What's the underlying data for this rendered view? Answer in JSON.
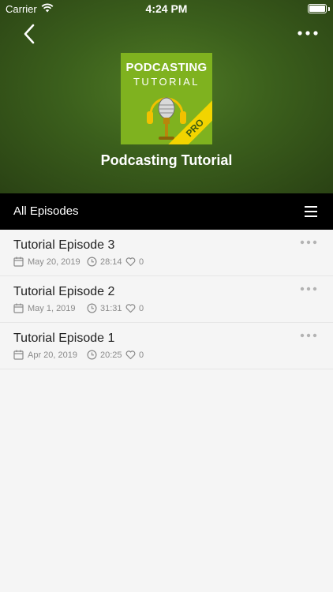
{
  "status_bar": {
    "carrier": "Carrier",
    "time": "4:24 PM"
  },
  "header": {
    "podcast_title": "Podcasting Tutorial",
    "artwork": {
      "line1": "PODCASTING",
      "line2": "TUTORIAL",
      "badge": "PRO"
    }
  },
  "tabbar": {
    "label": "All Episodes"
  },
  "episodes": [
    {
      "title": "Tutorial Episode 3",
      "date": "May 20, 2019",
      "duration": "28:14",
      "likes": "0"
    },
    {
      "title": "Tutorial Episode 2",
      "date": "May 1, 2019",
      "duration": "31:31",
      "likes": "0"
    },
    {
      "title": "Tutorial Episode 1",
      "date": "Apr 20, 2019",
      "duration": "20:25",
      "likes": "0"
    }
  ],
  "colors": {
    "header_bg": "#3b5f1c",
    "artwork_bg": "#7fb21f",
    "badge": "#f2d400",
    "tabbar_bg": "#000000"
  }
}
